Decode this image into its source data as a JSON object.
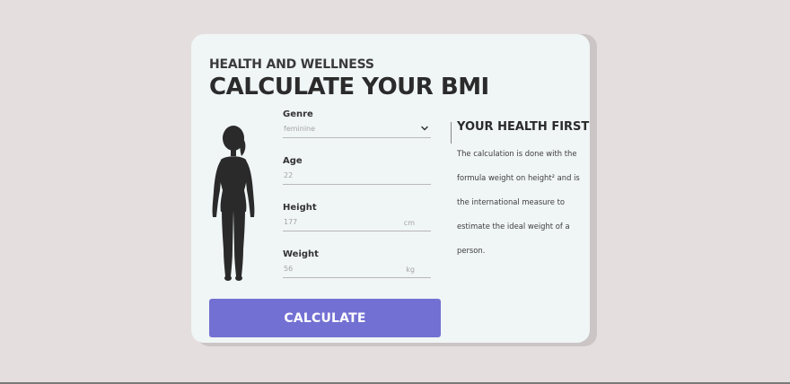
{
  "header": {
    "eyebrow": "HEALTH AND WELLNESS",
    "title": "CALCULATE YOUR BMI"
  },
  "form": {
    "genre": {
      "label": "Genre",
      "value": "feminine"
    },
    "age": {
      "label": "Age",
      "value": "22"
    },
    "height": {
      "label": "Height",
      "value": "177",
      "unit": "cm"
    },
    "weight": {
      "label": "Weight",
      "value": "56",
      "unit": "kg"
    },
    "submit_label": "CALCULATE"
  },
  "side": {
    "title": "YOUR HEALTH FIRST",
    "text": "The calculation is done with the formula weight on height² and is the international measure to estimate the ideal weight of a person."
  },
  "colors": {
    "background": "#e5dede",
    "card": "#f0f5f5",
    "accent": "#7370d3",
    "text": "#2b2b2b"
  },
  "icons": {
    "figure": "female-silhouette-icon",
    "dropdown": "chevron-down-icon"
  }
}
